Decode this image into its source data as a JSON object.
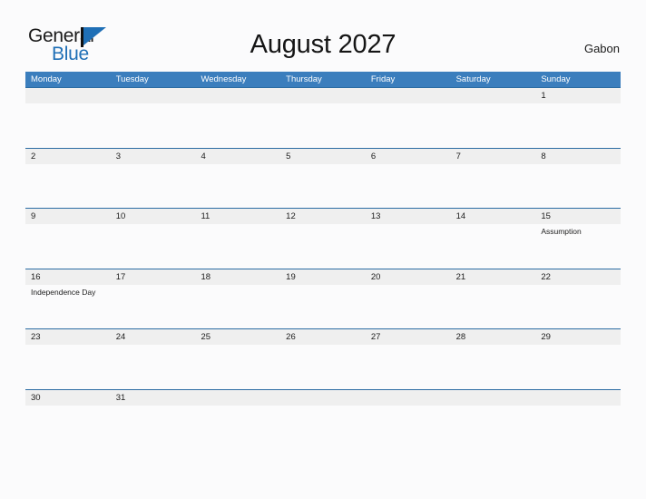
{
  "brand": {
    "name_top": "General",
    "name_bottom": "Blue",
    "accent_color": "#1f6fb6"
  },
  "header": {
    "title": "August 2027",
    "country": "Gabon"
  },
  "calendar": {
    "header_color": "#3b7ebd",
    "band_color": "#efefef",
    "border_color": "#2b6ca3",
    "weekdays": [
      "Monday",
      "Tuesday",
      "Wednesday",
      "Thursday",
      "Friday",
      "Saturday",
      "Sunday"
    ],
    "weeks": [
      [
        {
          "day": "",
          "event": ""
        },
        {
          "day": "",
          "event": ""
        },
        {
          "day": "",
          "event": ""
        },
        {
          "day": "",
          "event": ""
        },
        {
          "day": "",
          "event": ""
        },
        {
          "day": "",
          "event": ""
        },
        {
          "day": "1",
          "event": ""
        }
      ],
      [
        {
          "day": "2",
          "event": ""
        },
        {
          "day": "3",
          "event": ""
        },
        {
          "day": "4",
          "event": ""
        },
        {
          "day": "5",
          "event": ""
        },
        {
          "day": "6",
          "event": ""
        },
        {
          "day": "7",
          "event": ""
        },
        {
          "day": "8",
          "event": ""
        }
      ],
      [
        {
          "day": "9",
          "event": ""
        },
        {
          "day": "10",
          "event": ""
        },
        {
          "day": "11",
          "event": ""
        },
        {
          "day": "12",
          "event": ""
        },
        {
          "day": "13",
          "event": ""
        },
        {
          "day": "14",
          "event": ""
        },
        {
          "day": "15",
          "event": "Assumption"
        }
      ],
      [
        {
          "day": "16",
          "event": "Independence Day"
        },
        {
          "day": "17",
          "event": ""
        },
        {
          "day": "18",
          "event": ""
        },
        {
          "day": "19",
          "event": ""
        },
        {
          "day": "20",
          "event": ""
        },
        {
          "day": "21",
          "event": ""
        },
        {
          "day": "22",
          "event": ""
        }
      ],
      [
        {
          "day": "23",
          "event": ""
        },
        {
          "day": "24",
          "event": ""
        },
        {
          "day": "25",
          "event": ""
        },
        {
          "day": "26",
          "event": ""
        },
        {
          "day": "27",
          "event": ""
        },
        {
          "day": "28",
          "event": ""
        },
        {
          "day": "29",
          "event": ""
        }
      ],
      [
        {
          "day": "30",
          "event": ""
        },
        {
          "day": "31",
          "event": ""
        },
        {
          "day": "",
          "event": ""
        },
        {
          "day": "",
          "event": ""
        },
        {
          "day": "",
          "event": ""
        },
        {
          "day": "",
          "event": ""
        },
        {
          "day": "",
          "event": ""
        }
      ]
    ]
  }
}
